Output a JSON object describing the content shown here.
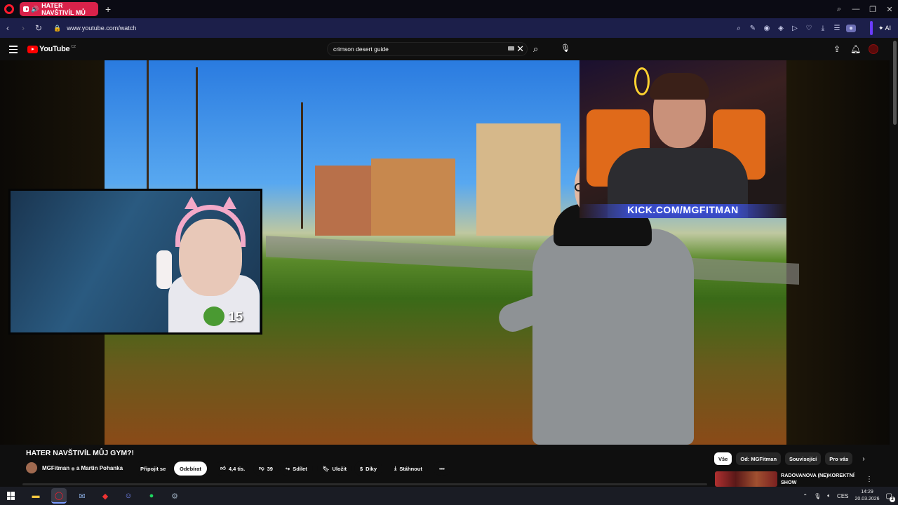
{
  "browser": {
    "tab_title": "HATER NAVŠTIVÍL MŮ",
    "url": "www.youtube.com/watch",
    "ai_label": "AI"
  },
  "youtube": {
    "logo_text": "YouTube",
    "region": "CZ",
    "search_value": "crimson desert guide"
  },
  "video": {
    "overlay_count": "15",
    "kick_banner": "KICK.COM/MGFITMAN"
  },
  "details": {
    "title": "HATER NAVŠTIVÍL MŮJ GYM?!",
    "channel": "MGFitman",
    "verified_glyph": "◉",
    "collab": "a Martin Pohanka",
    "join_label": "Připojit se",
    "subscribe_label": "Odebírat",
    "likes": "4,4 tis.",
    "dislikes": "39",
    "share_label": "Sdílet",
    "save_label": "Uložit",
    "thanks_label": "Díky",
    "download_label": "Stáhnout"
  },
  "chips": [
    "Vše",
    "Od: MGFitman",
    "Související",
    "Pro vás"
  ],
  "recommended": {
    "title": "RADOVANOVA (NE)KOREKTNÍ SHOW"
  },
  "taskbar": {
    "lang": "CES",
    "time": "14:29",
    "date": "20.03.2026",
    "notifications": "2"
  }
}
